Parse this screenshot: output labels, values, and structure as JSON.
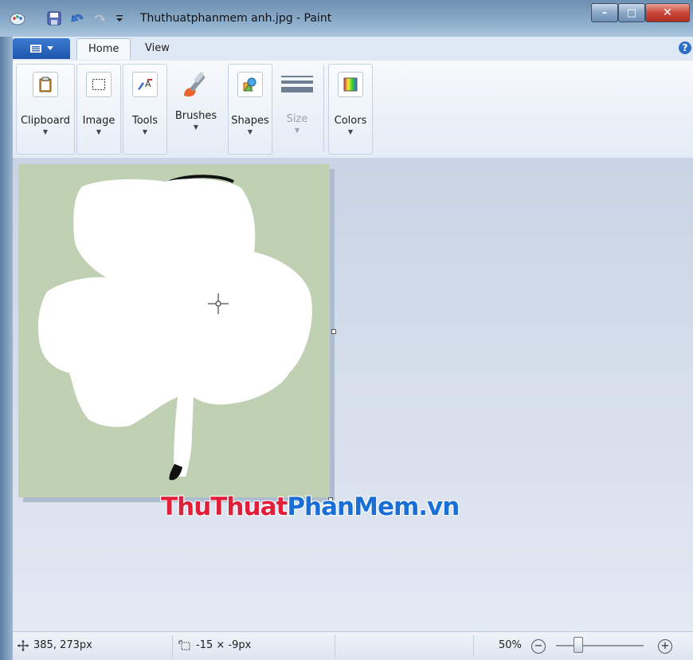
{
  "window": {
    "title": "Thuthuatphanmem anh.jpg - Paint",
    "minimize_label": "–",
    "maximize_label": "□",
    "close_label": "✕"
  },
  "quick_access": {
    "icons": [
      "paint-app-icon",
      "save-icon",
      "undo-icon",
      "redo-icon",
      "customize-dropdown-icon"
    ]
  },
  "tabs": {
    "paint_menu_icon": "paint-menu-icon",
    "home": "Home",
    "view": "View",
    "help_icon": "?"
  },
  "ribbon": {
    "groups": [
      {
        "label": "Clipboard",
        "icon": "clipboard-icon"
      },
      {
        "label": "Image",
        "icon": "image-select-icon"
      },
      {
        "label": "Tools",
        "icon": "tools-icon"
      },
      {
        "label": "Brushes",
        "icon": "brush-icon"
      },
      {
        "label": "Shapes",
        "icon": "shapes-icon"
      },
      {
        "label": "Size",
        "icon": "size-lines-icon",
        "disabled": true
      },
      {
        "label": "Colors",
        "icon": "colors-icon"
      }
    ],
    "dropdown_arrow": "▼"
  },
  "canvas": {
    "background": "#bfd0b3",
    "shape_color": "#ffffff"
  },
  "watermark": {
    "part1": "ThuThuat",
    "part2": "PhanMem.vn",
    "color1": "#e0203a",
    "color2": "#1a6fd6"
  },
  "statusbar": {
    "cursor_position": "385, 273px",
    "selection_size": "-15 × -9px",
    "zoom_level": "50%",
    "zoom_out": "−",
    "zoom_in": "+"
  }
}
